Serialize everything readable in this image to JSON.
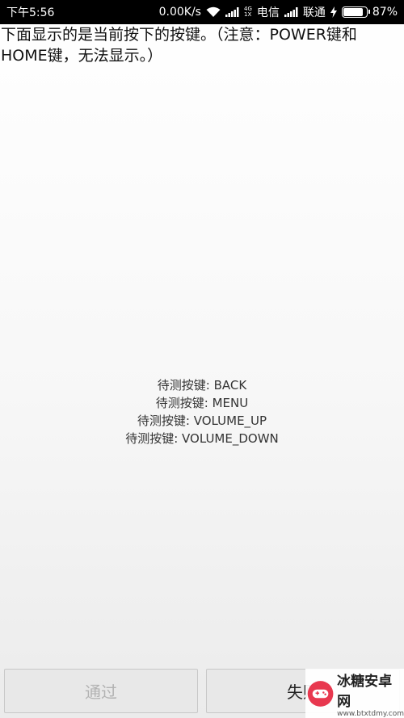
{
  "status_bar": {
    "time": "下午5:56",
    "net_speed": "0.00K/s",
    "net_badge_top": "4G",
    "net_badge_bottom": "1X",
    "carrier_1": "电信",
    "carrier_2": "联通",
    "battery": "87%",
    "battery_level": 0.87
  },
  "notice": "下面显示的是当前按下的按键。（注意：POWER键和HOME键，无法显示。）",
  "pending_keys": [
    "待测按键: BACK",
    "待测按键: MENU",
    "待测按键: VOLUME_UP",
    "待测按键: VOLUME_DOWN"
  ],
  "buttons": {
    "pass": "通过",
    "fail": "失败"
  },
  "watermark": {
    "title": "冰糖安卓网",
    "url": "www.btxtdmy.com"
  }
}
